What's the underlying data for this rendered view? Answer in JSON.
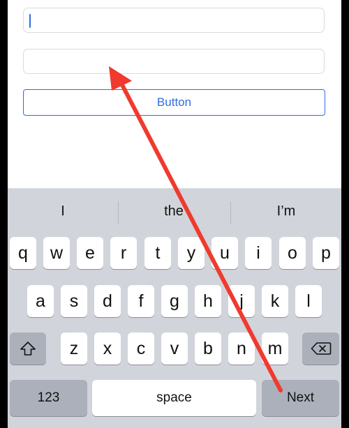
{
  "form": {
    "button_label": "Button"
  },
  "keyboard": {
    "suggestions": [
      "I",
      "the",
      "I’m"
    ],
    "row1": [
      "q",
      "w",
      "e",
      "r",
      "t",
      "y",
      "u",
      "i",
      "o",
      "p"
    ],
    "row2": [
      "a",
      "s",
      "d",
      "f",
      "g",
      "h",
      "j",
      "k",
      "l"
    ],
    "row3": [
      "z",
      "x",
      "c",
      "v",
      "b",
      "n",
      "m"
    ],
    "numbers_label": "123",
    "space_label": "space",
    "return_label": "Next"
  },
  "colors": {
    "accent": "#2f6de1",
    "annotation_arrow": "#f03a2e",
    "keyboard_bg": "#d1d4da"
  }
}
